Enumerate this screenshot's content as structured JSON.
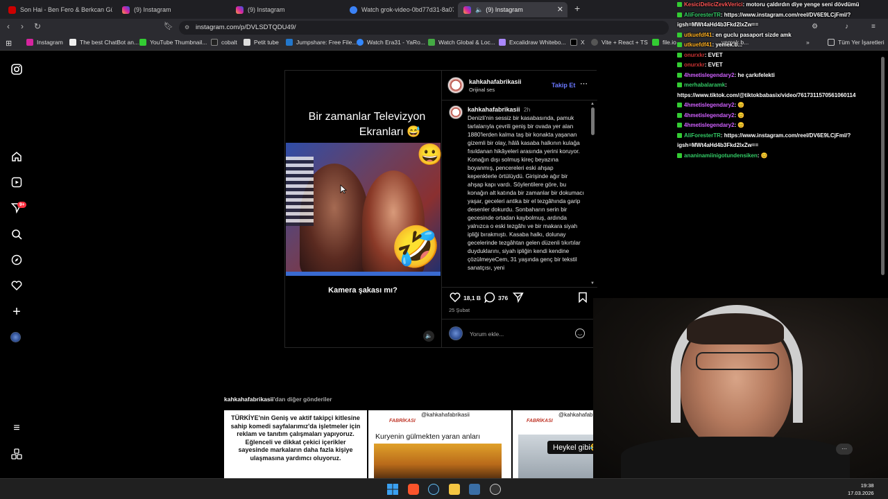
{
  "tabs": [
    {
      "label": "Son Hai - Ben Fero & Berkcan Güven",
      "active": false
    },
    {
      "label": "(9) Instagram",
      "active": false
    },
    {
      "label": "(9) Instagram",
      "active": false
    },
    {
      "label": "Watch grok-video-0bd77d31-8a07-4",
      "active": false
    },
    {
      "label": "(9) Instagram",
      "active": true
    }
  ],
  "new_tab_label": "+",
  "url": "instagram.com/p/DVLSDTQDU49/",
  "bookmarks": [
    "Instagram",
    "The best ChatBot an...",
    "YouTube Thumbnail...",
    "cobalt",
    "Petit tube",
    "Jumpshare: Free File...",
    "Watch Era31 - YaRo...",
    "Watch Global & Loc...",
    "Excalidraw Whitebo...",
    "X",
    "Vite + React + TS",
    "file.io",
    "yemek.b..."
  ],
  "bookmarks_all": "Tüm Yer İşaretleri",
  "sidebar": {
    "notification_count": "9+"
  },
  "video": {
    "title_line1": "Bir zamanlar Televizyon",
    "title_line2": "Ekranları 😅",
    "subtitle": "Kamera şakası mı?"
  },
  "post": {
    "username": "kahkahafabrikasii",
    "audio": "Orijinal ses",
    "follow": "Takip Et",
    "comment_user": "kahkahafabrikasii",
    "comment_time": "2h",
    "caption": "Denizli'nin sessiz bir kasabasında, pamuk tarlalarıyla çevrili geniş bir ovada yer alan 1880'lerden kalma taş bir konakta yaşanan gizemli bir olay, hâlâ kasaba halkının kulağa fısıldanan hikâyeleri arasında yerini koruyor. Konağın dışı solmuş kireç beyazına boyanmış, pencereleri eski ahşap kepenklerle örtülüydü. Girişinde ağır bir ahşap kapı vardı. Söylentilere göre, bu konağın alt katında bir zamanlar bir dokumacı yaşar, geceleri antika bir el tezgâhında garip desenler dokurdu. Sonbaharın serin bir gecesinde ortadan kaybolmuş, ardında yalnızca o eski tezgâhı ve bir makara siyah ipliği bırakmıştı. Kasaba halkı, dolunay gecelerinde tezgâhtan gelen düzenli tıkırtılar duyduklarını, siyah ipliğin kendi kendine çözülmeyeCem, 31 yaşında genç bir tekstil sanatçısı, yeni",
    "likes": "18,1 B",
    "comments": "376",
    "date": "25 Şubat",
    "comment_placeholder": "Yorum ekle..."
  },
  "more_posts": {
    "user": "kahkahafabrikasii",
    "suffix": "'dan diğer gönderiler",
    "thumb1": "TÜRKİYE'nin Geniş ve aktif takipçi kitlesine sahip komedi sayfalarımız'da işletmeler için reklam ve tanıtım çalışmaları yapıyoruz. Eğlenceli ve dikkat çekici içerikler sayesinde markaların daha fazla kişiye ulaşmasına yardımcı oluyoruz.",
    "thumb2_handle": "@kahkahafabrikasii",
    "thumb2_title": "Kuryenin gülmekten yaran anları",
    "thumb3_handle": "@kahkahafabrikasii",
    "thumb3_caption": "Heykel gibi😂🤣",
    "brand": "FABRİKASI"
  },
  "chat": [
    {
      "user": "KesiciDeliciZevkVerici",
      "msg": ": motoru çaldırdın diye yenge seni dövdümü",
      "color": "#ff5555"
    },
    {
      "user": "AliForesterTR",
      "msg": ": https://www.instagram.com/reel/DV6E9LCjFml/?igsh=MWt4aHd4b3Fkd2lxZw==",
      "color": "#33cc66"
    },
    {
      "user": "utkuefdf41",
      "msg": ": en guclu pasaport sizde amk",
      "color": "#ffb020"
    },
    {
      "user": "utkuefdf41",
      "msg": ": yemek.b...",
      "color": "#ffb020"
    },
    {
      "user": "onurxkr",
      "msg": ": EVET",
      "color": "#cc3333"
    },
    {
      "user": "onurxkr",
      "msg": ": EVET",
      "color": "#cc3333"
    },
    {
      "user": "4hmetislegendary2",
      "msg": ": he çarkıfelekti",
      "color": "#d060ff"
    },
    {
      "user": "merhabalaramk",
      "msg": ": https://www.tiktok.com/@tiktokbabasix/video/7617311570561060114",
      "color": "#33cc66"
    },
    {
      "user": "4hmetislegendary2",
      "msg": ": 😊",
      "color": "#d060ff"
    },
    {
      "user": "4hmetislegendary2",
      "msg": ": 😊",
      "color": "#d060ff"
    },
    {
      "user": "4hmetislegendary2",
      "msg": ": 😊",
      "color": "#d060ff"
    },
    {
      "user": "AliForesterTR",
      "msg": ": https://www.instagram.com/reel/DV6E9LCjFml/?igsh=MWt4aHd4b3Fkd2lxZw==",
      "color": "#33cc66"
    },
    {
      "user": "ananinamiinigotundensiken",
      "msg": ": 😊",
      "color": "#33cc66"
    }
  ],
  "clock": {
    "time": "19:38",
    "date": "17.03.2026"
  },
  "colors": {
    "accent": "#0095f6",
    "follow": "#6a78ff",
    "notif": "#ff3040"
  }
}
